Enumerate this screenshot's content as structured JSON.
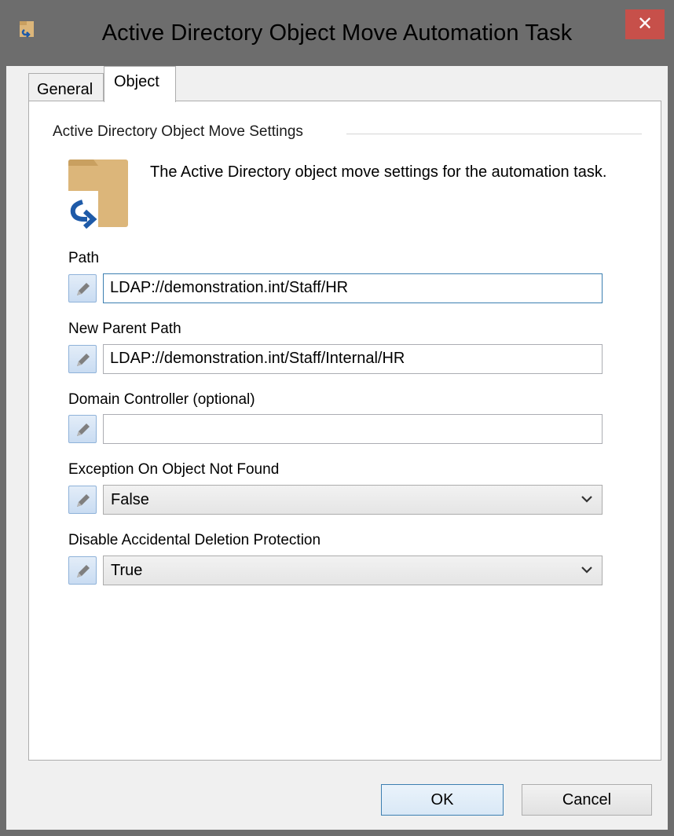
{
  "window": {
    "title": "Active Directory Object Move Automation Task",
    "close_label": "✕"
  },
  "tabs": [
    {
      "label": "General",
      "active": false
    },
    {
      "label": "Object",
      "active": true
    }
  ],
  "section": {
    "title": "Active Directory Object Move Settings",
    "description": "The Active Directory object move settings for the automation task."
  },
  "fields": {
    "path": {
      "label": "Path",
      "value": "LDAP://demonstration.int/Staff/HR"
    },
    "new_parent_path": {
      "label": "New Parent Path",
      "value": "LDAP://demonstration.int/Staff/Internal/HR"
    },
    "domain_controller": {
      "label": "Domain Controller (optional)",
      "value": ""
    },
    "exception_on_not_found": {
      "label": "Exception On Object Not Found",
      "value": "False"
    },
    "disable_deletion_protection": {
      "label": "Disable Accidental Deletion Protection",
      "value": "True"
    }
  },
  "buttons": {
    "ok": "OK",
    "cancel": "Cancel"
  },
  "colors": {
    "title_bar": "#6d6d6d",
    "close_button": "#c7504a",
    "folder": "#dcb67a",
    "arrow": "#1e5aa8",
    "focus_border": "#3c7fb1"
  },
  "icons": [
    "app-icon",
    "folder-move-icon",
    "pencil-icon",
    "chevron-down-icon",
    "close-icon"
  ]
}
